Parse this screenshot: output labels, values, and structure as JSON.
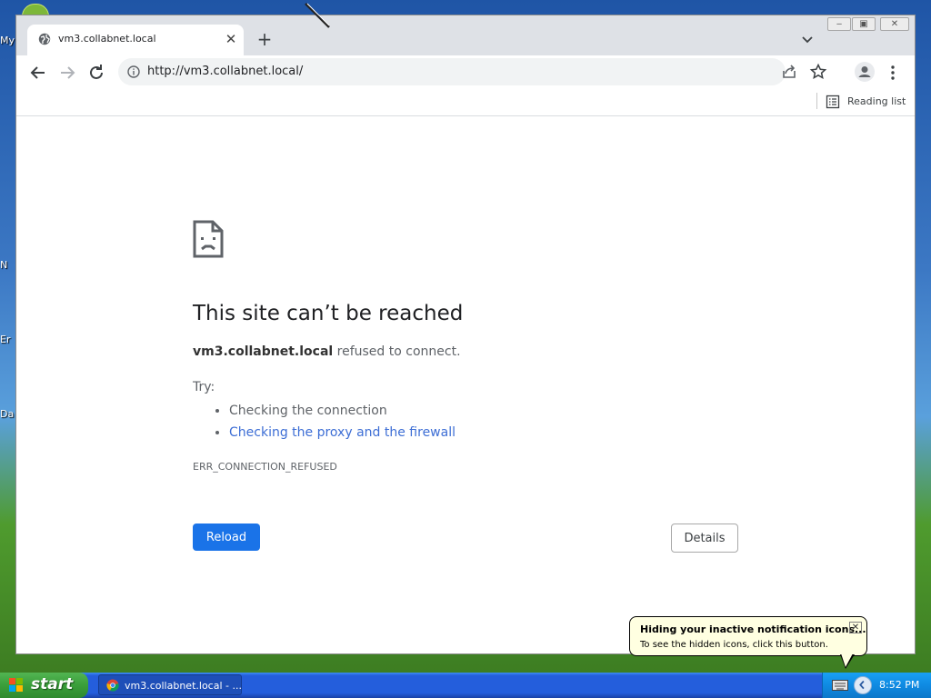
{
  "desktop": {
    "labels": [
      "My",
      "N",
      "Er",
      "Da"
    ]
  },
  "browser": {
    "tab": {
      "title": "vm3.collabnet.local",
      "favicon": "globe-icon"
    },
    "omnibox": {
      "url": "http://vm3.collabnet.local/"
    },
    "bookmarks_bar": {
      "reading_list": "Reading list"
    }
  },
  "error_page": {
    "title": "This site can’t be reached",
    "host": "vm3.collabnet.local",
    "message": " refused to connect.",
    "try_label": "Try:",
    "suggestions": [
      "Checking the connection",
      "Checking the proxy and the firewall"
    ],
    "error_code": "ERR_CONNECTION_REFUSED",
    "reload_label": "Reload",
    "details_label": "Details"
  },
  "balloon": {
    "title": "Hiding your inactive notification icons...",
    "text": "To see the hidden icons, click this button."
  },
  "taskbar": {
    "start_label": "start",
    "task_label": "vm3.collabnet.local - ...",
    "clock": "8:52 PM"
  },
  "colors": {
    "accent": "#1a73e8",
    "link": "#3d6ed5",
    "taskbar": "#245edc",
    "start": "#3a9e3a"
  }
}
